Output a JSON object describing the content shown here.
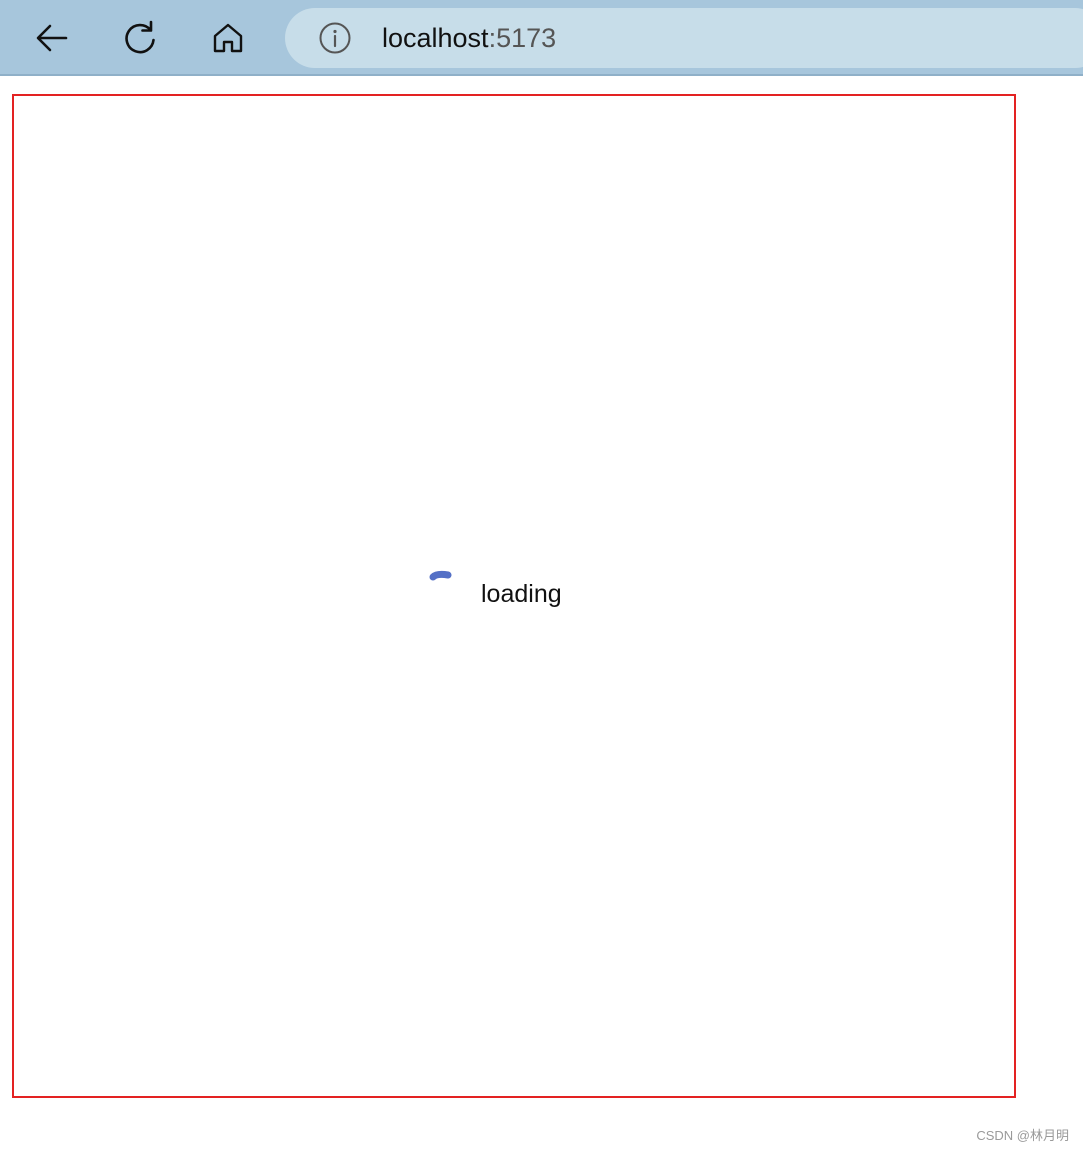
{
  "browser": {
    "address": {
      "host": "localhost",
      "port": ":5173"
    },
    "icons": {
      "back": "back-arrow-icon",
      "reload": "reload-icon",
      "home": "home-icon",
      "info": "info-icon"
    }
  },
  "page": {
    "loading_text": "loading",
    "spinner_icon": "spinner-icon",
    "spinner_color": "#5470c6",
    "frame_border_color": "#e32222"
  },
  "watermark": "CSDN @林月明"
}
